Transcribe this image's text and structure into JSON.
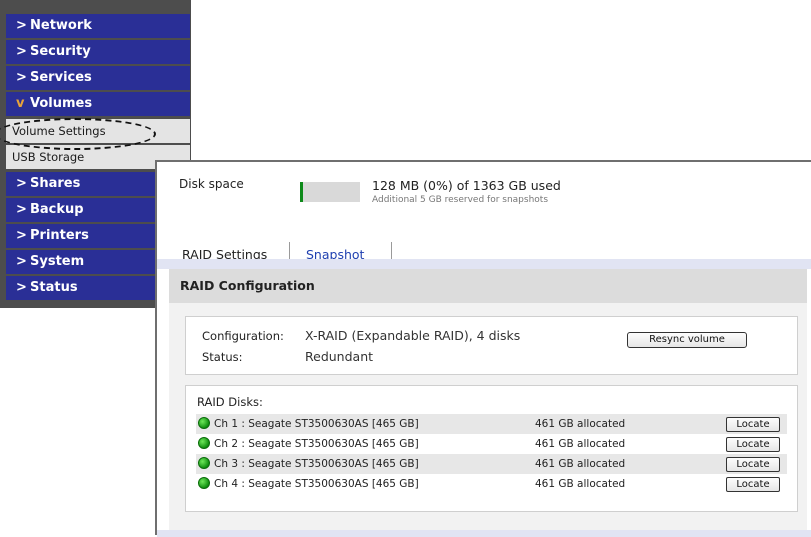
{
  "sidebar": {
    "items": [
      {
        "label": "Network"
      },
      {
        "label": "Security"
      },
      {
        "label": "Services"
      },
      {
        "label": "Volumes"
      },
      {
        "label": "Volume Settings"
      },
      {
        "label": "USB Storage"
      },
      {
        "label": "Shares"
      },
      {
        "label": "Backup"
      },
      {
        "label": "Printers"
      },
      {
        "label": "System"
      },
      {
        "label": "Status"
      }
    ],
    "expanded_item": "Volumes",
    "chevron_collapsed": ">",
    "chevron_expanded": "v",
    "colors": {
      "nav_bg": "#2a2f96",
      "expanded_chevron": "#e8a33a"
    }
  },
  "disk_space": {
    "label": "Disk space",
    "used_text": "128 MB (0%) of 1363 GB used",
    "reserved_text": "Additional 5 GB reserved for snapshots",
    "used_percent": 0,
    "bar_color": "#0e8a1a"
  },
  "tabs": [
    {
      "label": "RAID Settings",
      "active": true
    },
    {
      "label": "Snapshot",
      "active": false
    }
  ],
  "raid": {
    "section_title": "RAID Configuration",
    "configuration_label": "Configuration:",
    "configuration_value": "X-RAID (Expandable RAID), 4 disks",
    "status_label": "Status:",
    "status_value": "Redundant",
    "resync_button": "Resync volume",
    "disks_label": "RAID Disks:",
    "disks": [
      {
        "name": "Ch 1 : Seagate ST3500630AS [465 GB]",
        "allocated": "461 GB allocated",
        "button": "Locate"
      },
      {
        "name": "Ch 2 : Seagate ST3500630AS [465 GB]",
        "allocated": "461 GB allocated",
        "button": "Locate"
      },
      {
        "name": "Ch 3 : Seagate ST3500630AS [465 GB]",
        "allocated": "461 GB allocated",
        "button": "Locate"
      },
      {
        "name": "Ch 4 : Seagate ST3500630AS [465 GB]",
        "allocated": "461 GB allocated",
        "button": "Locate"
      }
    ],
    "disk_status_color": "#1fae1f"
  }
}
